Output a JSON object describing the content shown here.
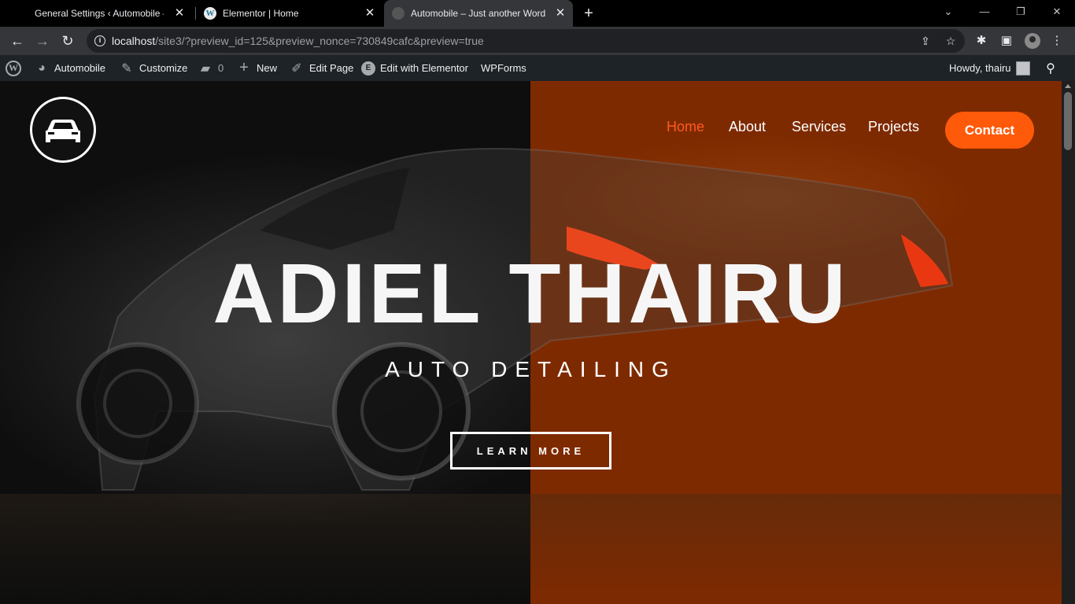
{
  "browser": {
    "tabs": [
      {
        "title": "General Settings ‹ Automobile —",
        "active": false
      },
      {
        "title": "Elementor | Home",
        "active": false
      },
      {
        "title": "Automobile – Just another Word",
        "active": true
      }
    ],
    "url_host": "localhost",
    "url_path": "/site3/?preview_id=125&preview_nonce=730849cafc&preview=true"
  },
  "adminbar": {
    "site_name": "Automobile",
    "customize": "Customize",
    "comments_count": "0",
    "new": "New",
    "edit_page": "Edit Page",
    "edit_elementor": "Edit with Elementor",
    "wpforms": "WPForms",
    "howdy": "Howdy, thairu"
  },
  "site": {
    "nav": [
      "Home",
      "About",
      "Services",
      "Projects"
    ],
    "active_nav": "Home",
    "contact": "Contact",
    "hero_title": "ADIEL THAIRU",
    "hero_subtitle": "AUTO DETAILING",
    "cta": "LEARN MORE"
  },
  "colors": {
    "accent": "#ff5a0a",
    "right_panel": "#7e2a00",
    "adminbar": "#1d2327"
  }
}
